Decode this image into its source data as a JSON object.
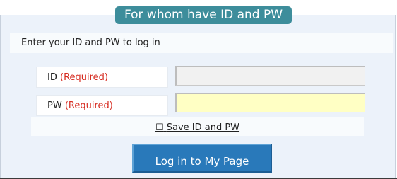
{
  "header": {
    "title": "For whom have ID and PW"
  },
  "intro": {
    "text": "Enter your ID and PW to log in"
  },
  "fields": {
    "id": {
      "label": "ID",
      "required_text": "(Required)",
      "value": "",
      "placeholder": ""
    },
    "pw": {
      "label": "PW",
      "required_text": "(Required)",
      "value": "",
      "placeholder": ""
    }
  },
  "save": {
    "checkbox_glyph": "☐",
    "label": "Save ID and PW"
  },
  "login_button": {
    "label": "Log in to My Page"
  },
  "colors": {
    "header_bg": "#3d8d9b",
    "panel_bg": "#ecf2fa",
    "required_red": "#d62b20",
    "pw_field_bg": "#ffffc4",
    "button_bg": "#2979ba"
  }
}
